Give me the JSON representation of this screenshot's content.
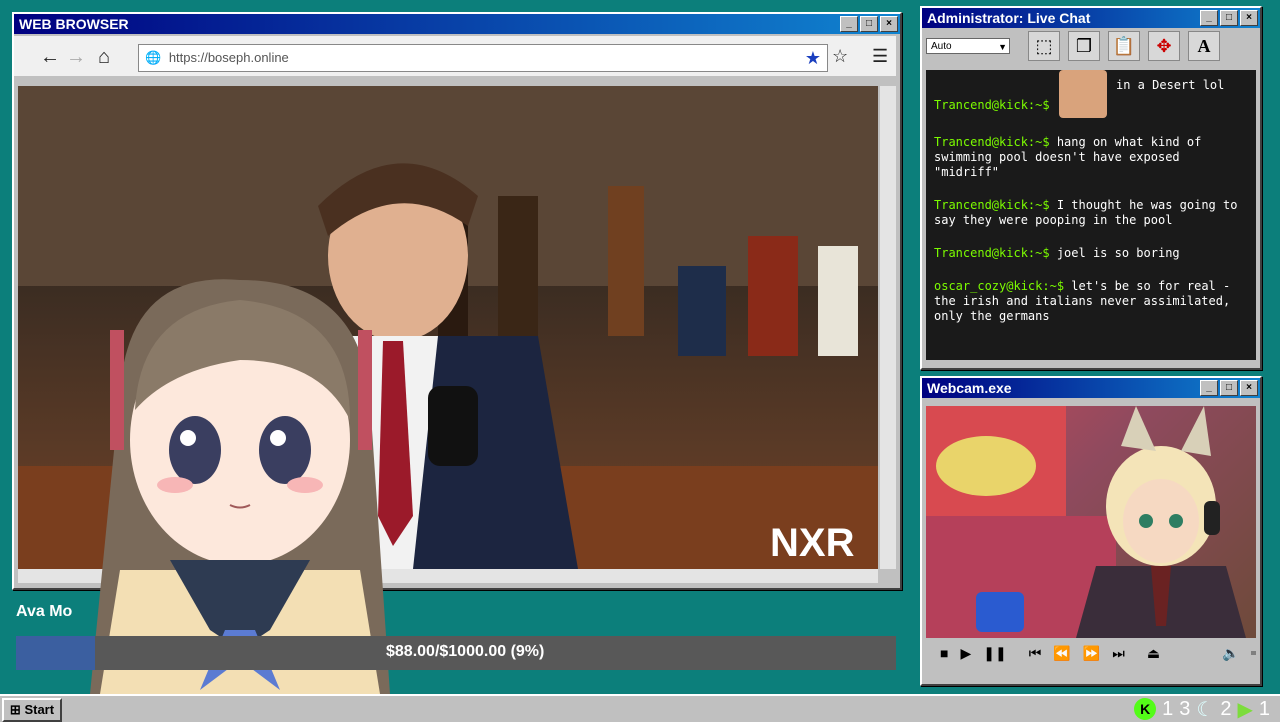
{
  "browser": {
    "title": "WEB BROWSER",
    "url": "https://boseph.online",
    "nav": {
      "back": "←",
      "forward": "→",
      "home": "⌂"
    }
  },
  "video": {
    "watermark": "NXR"
  },
  "chat": {
    "title": "Administrator: Live Chat",
    "font_select": "Auto",
    "messages": [
      {
        "user": "Trancend@kick:~$",
        "text": "in a Desert lol"
      },
      {
        "user": "Trancend@kick:~$",
        "text": "hang on what kind of swimming pool doesn't have exposed \"midriff\""
      },
      {
        "user": "Trancend@kick:~$",
        "text": "I thought he was going to say they were pooping in the pool"
      },
      {
        "user": "Trancend@kick:~$",
        "text": "joel is so boring"
      },
      {
        "user": "oscar_cozy@kick:~$",
        "text": "let's be so for real - the irish and italians never assimilated, only the germans"
      }
    ]
  },
  "webcam": {
    "title": "Webcam.exe"
  },
  "goal": {
    "name": "Ava Mo",
    "text": "$88.00/$1000.00 (9%)",
    "progress": 0.09
  },
  "taskbar": {
    "start": "Start",
    "tray": [
      "1",
      "3",
      "2",
      "1"
    ]
  },
  "colors": {
    "desktop": "#0c7f7b",
    "title_bar": "#000080",
    "chat_user": "#7CFC00"
  }
}
